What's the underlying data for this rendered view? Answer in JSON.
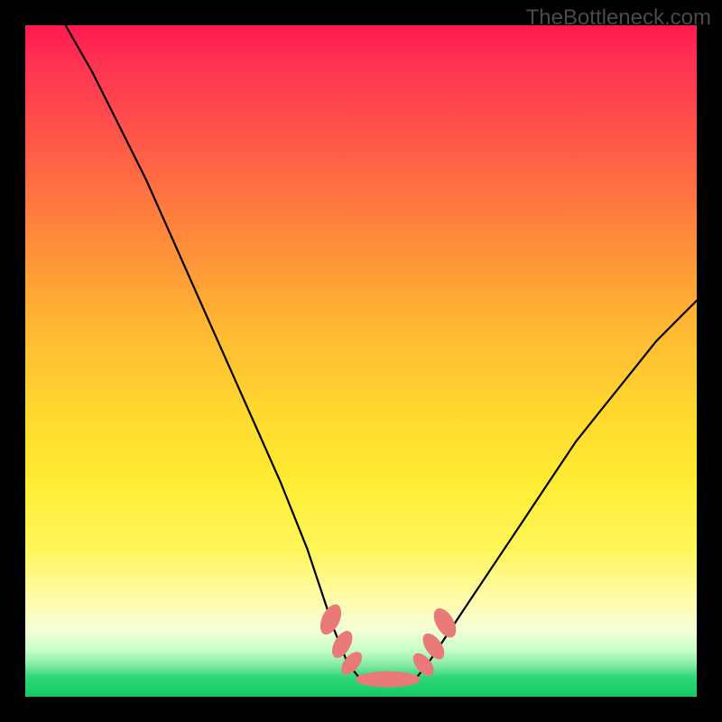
{
  "watermark": "TheBottleneck.com",
  "colors": {
    "frame": "#000000",
    "curve": "#000000",
    "marker": "#e97a77",
    "gradient_top": "#ff1a50",
    "gradient_bottom": "#18c864"
  },
  "chart_data": {
    "type": "line",
    "title": "",
    "xlabel": "",
    "ylabel": "",
    "xlim": [
      0,
      100
    ],
    "ylim": [
      0,
      100
    ],
    "series": [
      {
        "name": "left-curve",
        "x": [
          6,
          10,
          14,
          18,
          22,
          26,
          30,
          34,
          38,
          42,
          44,
          46,
          48,
          50
        ],
        "y": [
          100,
          93,
          85,
          77,
          68,
          59,
          50,
          41,
          32,
          22,
          16,
          10,
          5,
          2.5
        ]
      },
      {
        "name": "right-curve",
        "x": [
          58,
          60,
          62,
          66,
          70,
          74,
          78,
          82,
          86,
          90,
          94,
          98,
          100
        ],
        "y": [
          2.5,
          5,
          8,
          14,
          20,
          26,
          32,
          38,
          43,
          48,
          53,
          57,
          59
        ]
      },
      {
        "name": "floor",
        "x": [
          50,
          52,
          54,
          56,
          58
        ],
        "y": [
          2.5,
          2.4,
          2.4,
          2.4,
          2.5
        ]
      }
    ],
    "markers": [
      {
        "x": 45.5,
        "y": 11.5,
        "rx": 1.3,
        "ry": 2.4,
        "rot": 25
      },
      {
        "x": 47.2,
        "y": 7.8,
        "rx": 1.2,
        "ry": 2.2,
        "rot": 30
      },
      {
        "x": 48.6,
        "y": 5.0,
        "rx": 1.1,
        "ry": 2.0,
        "rot": 40
      },
      {
        "x": 54.0,
        "y": 2.6,
        "rx": 4.8,
        "ry": 1.2,
        "rot": 0
      },
      {
        "x": 59.3,
        "y": 4.8,
        "rx": 1.1,
        "ry": 2.0,
        "rot": -40
      },
      {
        "x": 60.8,
        "y": 7.5,
        "rx": 1.2,
        "ry": 2.2,
        "rot": -35
      },
      {
        "x": 62.5,
        "y": 11.0,
        "rx": 1.3,
        "ry": 2.4,
        "rot": -30
      }
    ]
  }
}
